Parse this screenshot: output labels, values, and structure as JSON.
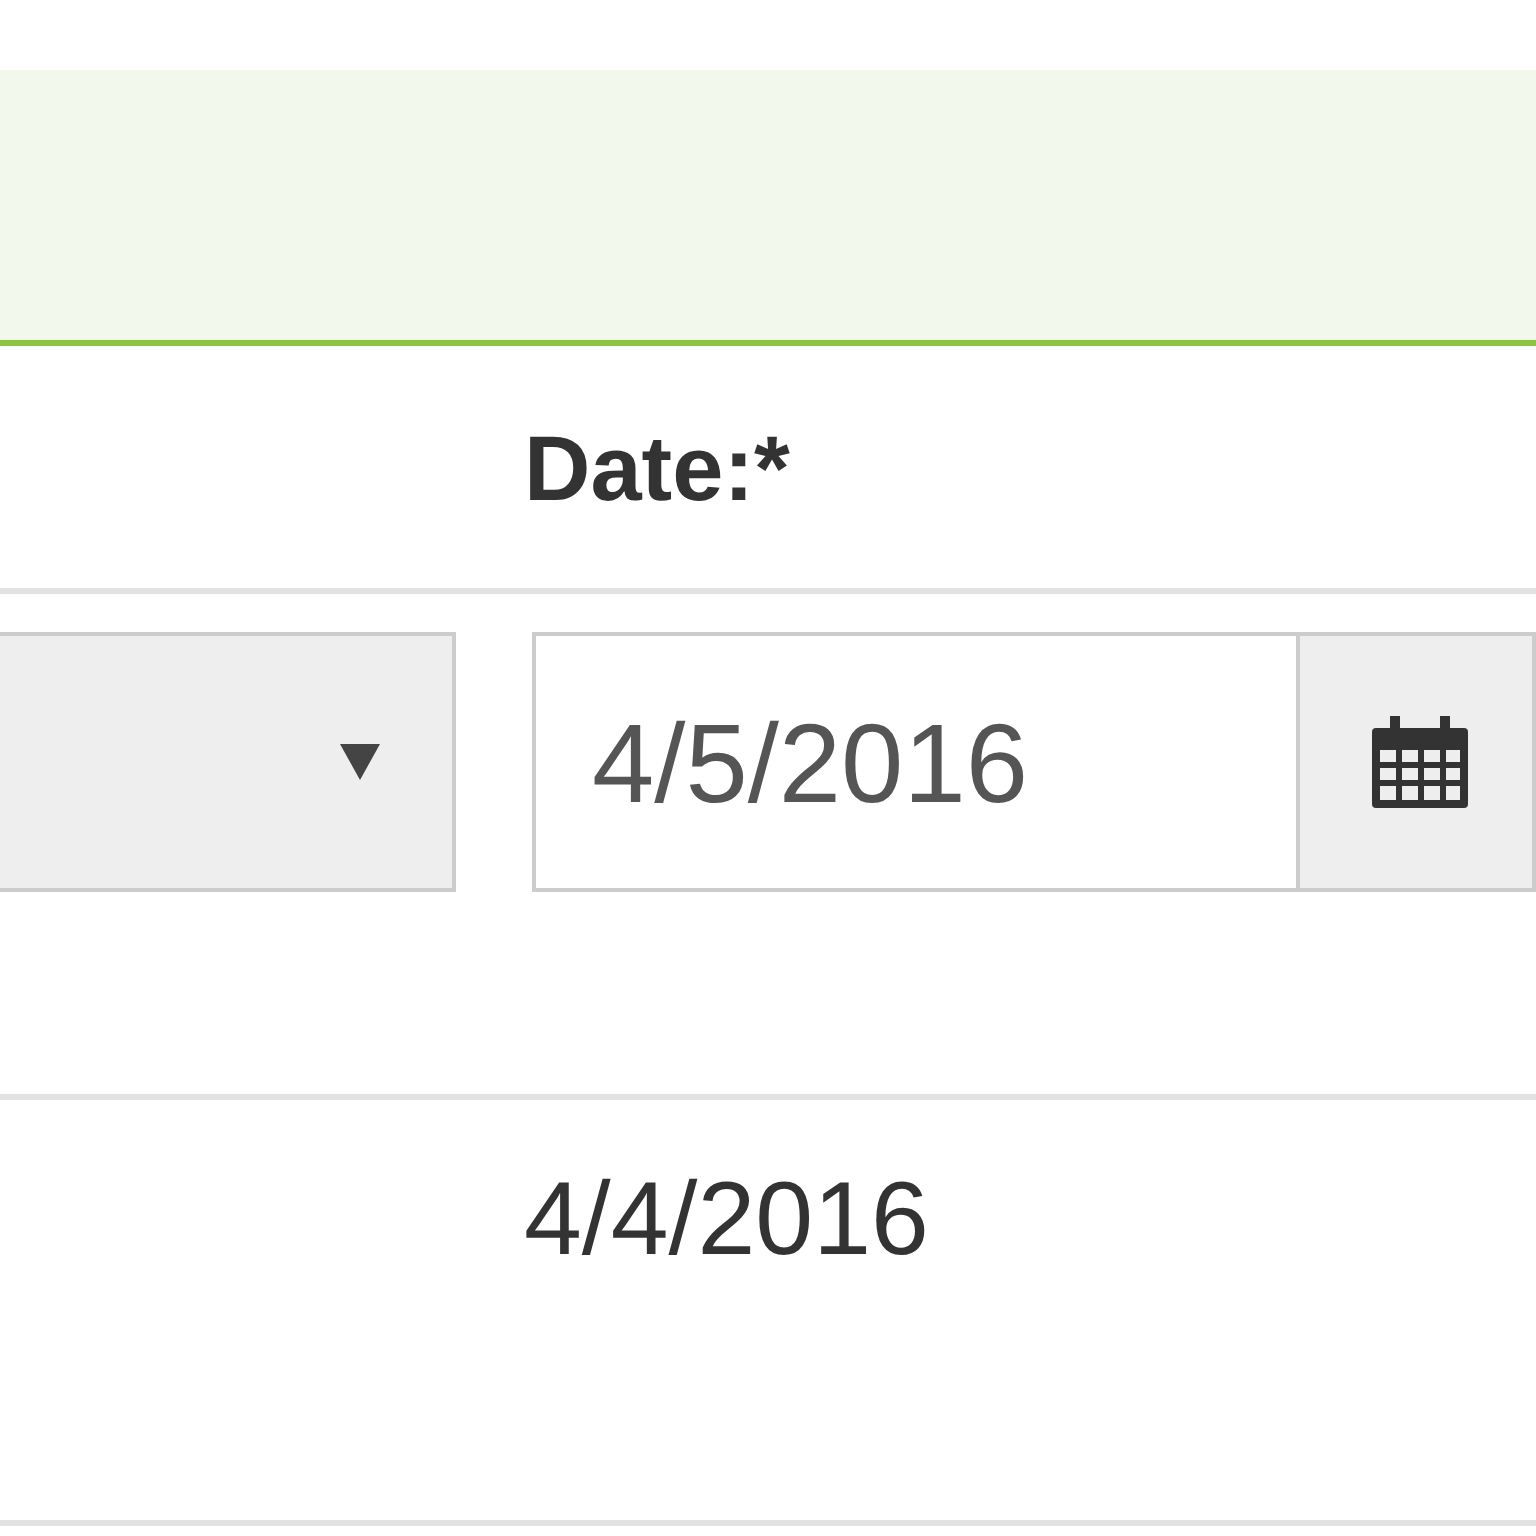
{
  "header": {
    "date_label": "Date:*"
  },
  "filter_row": {
    "dropdown": {
      "expanded": false
    },
    "date_field": {
      "value": "4/5/2016"
    }
  },
  "rows": [
    {
      "date": "4/4/2016"
    }
  ]
}
